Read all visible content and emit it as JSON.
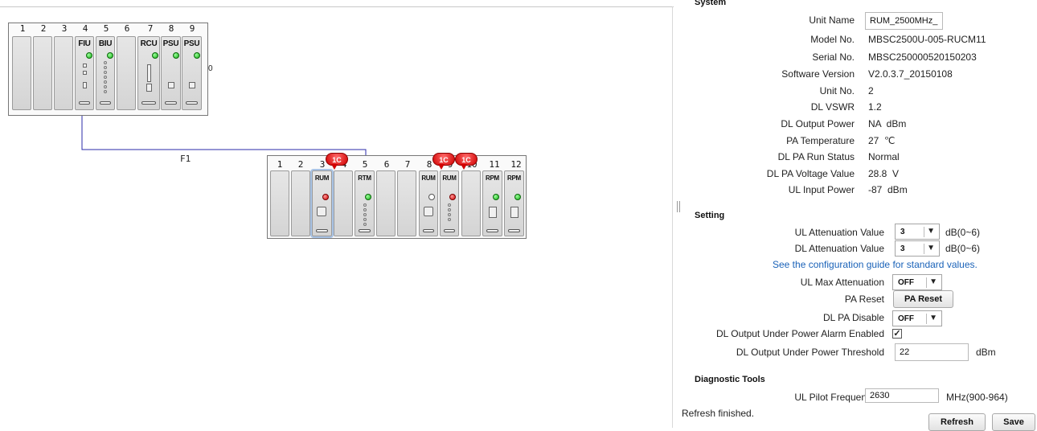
{
  "topology": {
    "upper_shelf": {
      "slots": [
        "1",
        "2",
        "3",
        "4",
        "5",
        "6",
        "7",
        "8",
        "9"
      ],
      "cards": [
        {
          "slot_index": 3,
          "label": "FIU"
        },
        {
          "slot_index": 4,
          "label": "BIU"
        },
        {
          "slot_index": 6,
          "label": "RCU"
        },
        {
          "slot_index": 7,
          "label": "PSU"
        },
        {
          "slot_index": 8,
          "label": "PSU"
        }
      ],
      "side_mark": "0"
    },
    "link_label": "F1",
    "lower_shelf": {
      "slots": [
        "1",
        "2",
        "3",
        "4",
        "5",
        "6",
        "7",
        "8",
        "9",
        "10",
        "11",
        "12"
      ],
      "cards": [
        {
          "slot_index": 2,
          "label": "RUM"
        },
        {
          "slot_index": 4,
          "label": "RTM"
        },
        {
          "slot_index": 7,
          "label": "RUM"
        },
        {
          "slot_index": 8,
          "label": "RUM"
        },
        {
          "slot_index": 10,
          "label": "RPM"
        },
        {
          "slot_index": 11,
          "label": "RPM"
        }
      ],
      "badges": [
        "1C",
        "1C",
        "1C"
      ]
    }
  },
  "system": {
    "title": "System",
    "unit_name_label": "Unit Name",
    "unit_name_value": "RUM_2500MHz_",
    "rows": [
      {
        "label": "Model No.",
        "value": "MBSC2500U-005-RUCM11"
      },
      {
        "label": "Serial No.",
        "value": "MBSC250000520150203"
      },
      {
        "label": "Software Version",
        "value": "V2.0.3.7_20150108"
      },
      {
        "label": "Unit No.",
        "value": "2"
      },
      {
        "label": "DL VSWR",
        "value": "1.2"
      },
      {
        "label": "DL Output Power",
        "value": "NA  dBm"
      },
      {
        "label": "PA Temperature",
        "value": "27  ℃"
      },
      {
        "label": "DL PA Run Status",
        "value": "Normal"
      },
      {
        "label": "DL PA Voltage Value",
        "value": "28.8  V"
      },
      {
        "label": "UL Input Power",
        "value": "-87  dBm"
      }
    ]
  },
  "setting": {
    "title": "Setting",
    "ul_att_label": "UL Attenuation Value",
    "ul_att_value": "3",
    "ul_att_range": "dB(0~6)",
    "dl_att_label": "DL Attenuation Value",
    "dl_att_value": "3",
    "dl_att_range": "dB(0~6)",
    "guide_link": "See the configuration guide for standard values.",
    "ul_max_att_label": "UL Max Attenuation",
    "ul_max_att_value": "OFF",
    "pa_reset_label": "PA Reset",
    "pa_reset_button": "PA Reset",
    "dl_pa_disable_label": "DL PA Disable",
    "dl_pa_disable_value": "OFF",
    "alarm_enabled_label": "DL Output Under Power Alarm Enabled",
    "alarm_enabled_checked": true,
    "threshold_label": "DL Output Under Power Threshold",
    "threshold_value": "22",
    "threshold_unit": "dBm"
  },
  "diagnostic": {
    "title": "Diagnostic Tools",
    "pilot_label": "UL Pilot Frequency",
    "pilot_value": "2630",
    "pilot_unit": "MHz(900-964)"
  },
  "footer": {
    "status": "Refresh finished.",
    "refresh_button": "Refresh",
    "save_button": "Save"
  },
  "colors": {
    "link": "#1a62b8",
    "led_green": "#16b016",
    "led_red": "#d00000",
    "badge": "#d10000",
    "connection_line": "#2b2ba8"
  }
}
